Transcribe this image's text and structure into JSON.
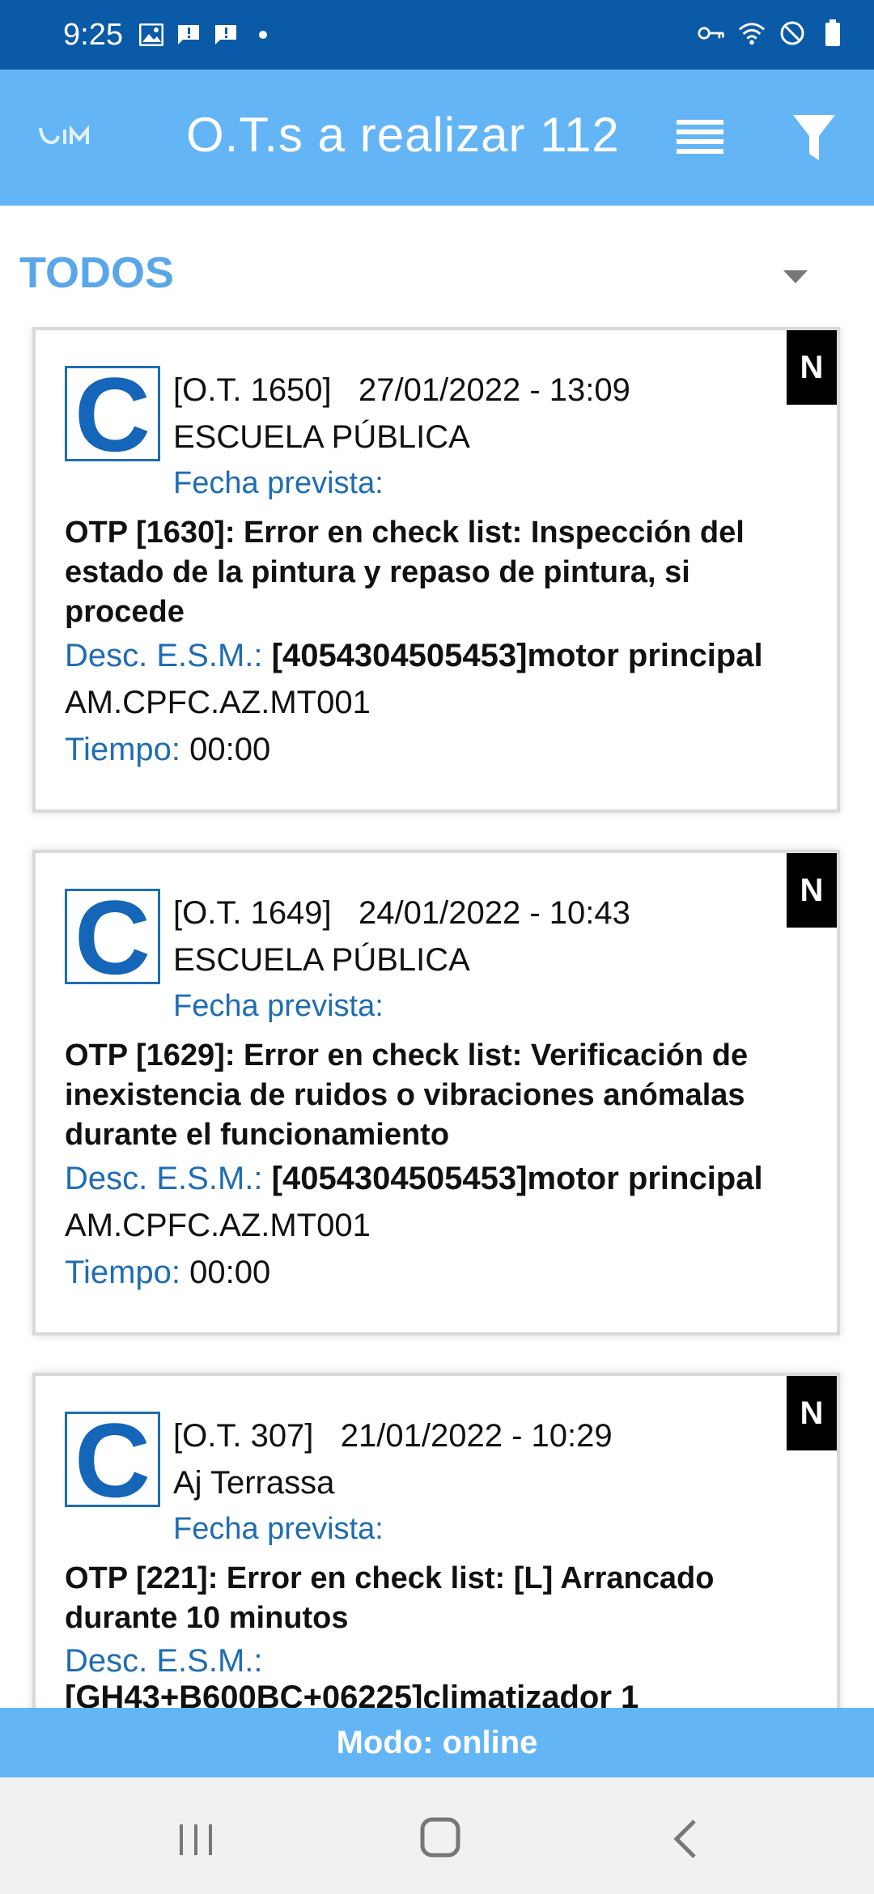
{
  "status_bar": {
    "time": "9:25",
    "left_icons": [
      "image-icon",
      "message-icon",
      "message-icon",
      "dot-icon"
    ],
    "right_icons": [
      "key-icon",
      "wifi-icon",
      "block-icon",
      "battery-icon"
    ]
  },
  "app_bar": {
    "title": "O.T.s a realizar 112",
    "logo_icon": "app-logo",
    "menu_icon": "menu-icon",
    "filter_icon": "filter-icon"
  },
  "filter": {
    "selected": "TODOS"
  },
  "cards": [
    {
      "type_letter": "C",
      "badge": "N",
      "ot_number": "[O.T. 1650]",
      "datetime": "27/01/2022 - 13:09",
      "place": "ESCUELA PÚBLICA",
      "fecha_label": "Fecha prevista:",
      "otp_text": "OTP [1630]: Error en check list: Inspección del estado de la pintura y repaso de pintura, si procede",
      "desc_label": "Desc. E.S.M.:",
      "desc_value": "[4054304505453]motor principal",
      "code": "AM.CPFC.AZ.MT001",
      "tiempo_label": "Tiempo:",
      "tiempo_value": "00:00"
    },
    {
      "type_letter": "C",
      "badge": "N",
      "ot_number": "[O.T. 1649]",
      "datetime": "24/01/2022 - 10:43",
      "place": "ESCUELA PÚBLICA",
      "fecha_label": "Fecha prevista:",
      "otp_text": "OTP [1629]: Error en check list: Verificación de inexistencia de ruidos o vibraciones anómalas durante el funcionamiento",
      "desc_label": "Desc. E.S.M.:",
      "desc_value": "[4054304505453]motor principal",
      "code": "AM.CPFC.AZ.MT001",
      "tiempo_label": "Tiempo:",
      "tiempo_value": "00:00"
    },
    {
      "type_letter": "C",
      "badge": "N",
      "ot_number": "[O.T. 307]",
      "datetime": "21/01/2022 - 10:29",
      "place": "Aj Terrassa",
      "fecha_label": "Fecha prevista:",
      "otp_text": "OTP [221]: Error en check list: [L] Arrancado durante 10 minutos",
      "desc_label": "Desc. E.S.M.:",
      "desc_value": "[GH43+B600BC+06225]climatizador 1"
    }
  ],
  "mode_bar": {
    "text": "Modo: online"
  },
  "nav_bar": {
    "icons": [
      "recents-icon",
      "home-icon",
      "back-icon"
    ]
  },
  "colors": {
    "status_bar": "#0b5aa8",
    "app_bar": "#64b5f6",
    "accent_blue": "#1f6db3",
    "filter_text": "#5aa6ea"
  }
}
